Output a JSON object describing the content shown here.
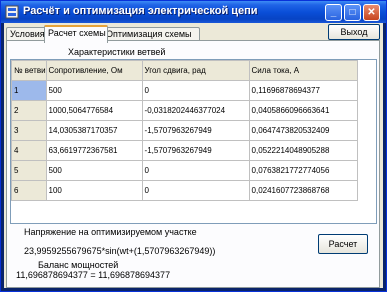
{
  "window": {
    "title": "Расчёт и оптимизация электрической цепи",
    "controls": {
      "minimize": "_",
      "maximize": "□",
      "close": "✕"
    }
  },
  "tabs": [
    {
      "label": "Условия"
    },
    {
      "label": "Расчет схемы"
    },
    {
      "label": "Оптимизация схемы"
    }
  ],
  "exit_button": "Выход",
  "grid": {
    "caption": "Характеристики ветвей",
    "columns": [
      "№ ветви",
      "Сопротивление, Ом",
      "Угол сдвига, рад",
      "Сила тока, А"
    ],
    "rows": [
      [
        "1",
        "500",
        "0",
        "0,11696878694377"
      ],
      [
        "2",
        "1000,5064776584",
        "-0,0318202446377024",
        "0,0405866096663641"
      ],
      [
        "3",
        "14,0305387170357",
        "-1,5707963267949",
        "0,0647473820532409"
      ],
      [
        "4",
        "63,6619772367581",
        "-1,5707963267949",
        "0,0522214048905288"
      ],
      [
        "5",
        "500",
        "0",
        "0,0763821772774056"
      ],
      [
        "6",
        "100",
        "0",
        "0,0241607723868768"
      ]
    ],
    "selected_row": 1
  },
  "voltage": {
    "label": "Напряжение на оптимизируемом участке",
    "value": "23,9959255679675*sin(wt+(1,5707963267949))"
  },
  "balance": {
    "label": "Баланс мощностей",
    "value": "11,696878694377 = 11,696878694377"
  },
  "calc_button": "Расчет"
}
